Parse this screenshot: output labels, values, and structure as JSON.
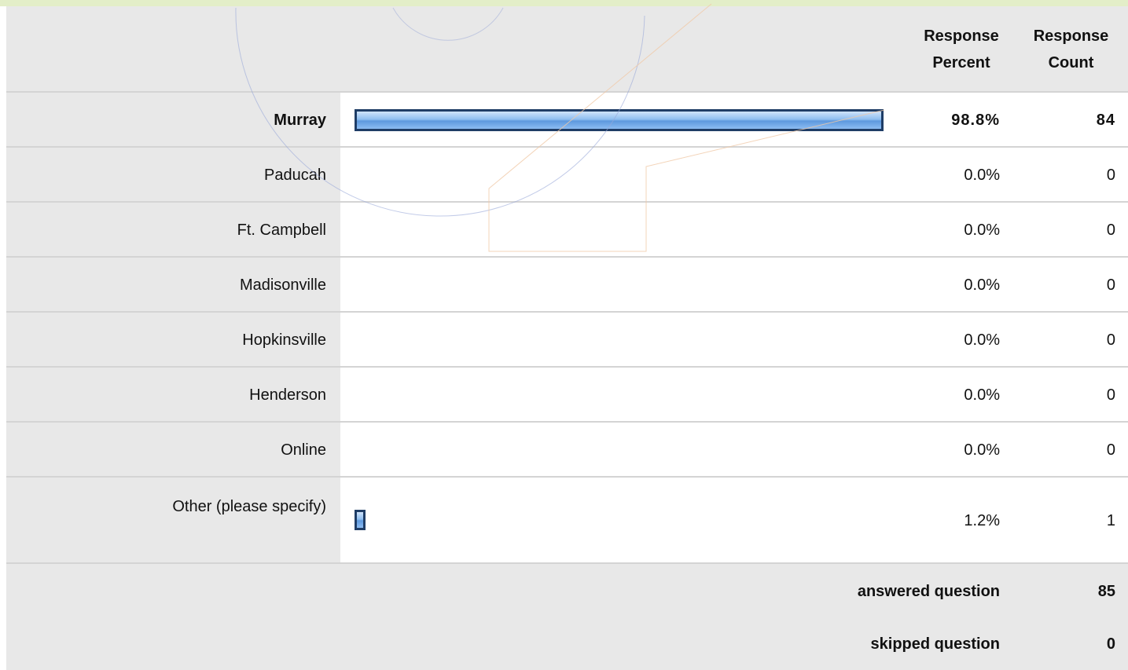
{
  "chart_data": {
    "type": "table",
    "columns": [
      "",
      "",
      "Response Percent",
      "Response Count"
    ],
    "header": {
      "percent_label": "Response Percent",
      "count_label": "Response Count"
    },
    "rows": [
      {
        "label": "Murray",
        "percent": "98.8%",
        "count": "84",
        "value": 98.8,
        "bold": true
      },
      {
        "label": "Paducah",
        "percent": "0.0%",
        "count": "0",
        "value": 0
      },
      {
        "label": "Ft. Campbell",
        "percent": "0.0%",
        "count": "0",
        "value": 0
      },
      {
        "label": "Madisonville",
        "percent": "0.0%",
        "count": "0",
        "value": 0
      },
      {
        "label": "Hopkinsville",
        "percent": "0.0%",
        "count": "0",
        "value": 0
      },
      {
        "label": "Henderson",
        "percent": "0.0%",
        "count": "0",
        "value": 0
      },
      {
        "label": "Online",
        "percent": "0.0%",
        "count": "0",
        "value": 0
      },
      {
        "label": "Other (please specify)",
        "percent": "1.2%",
        "count": "1",
        "value": 1.2
      }
    ],
    "summary": [
      {
        "label": "answered question",
        "value": "85"
      },
      {
        "label": "skipped question",
        "value": "0"
      }
    ],
    "bar_color": "#5d99de",
    "bar_border_color": "#1f3d66"
  }
}
